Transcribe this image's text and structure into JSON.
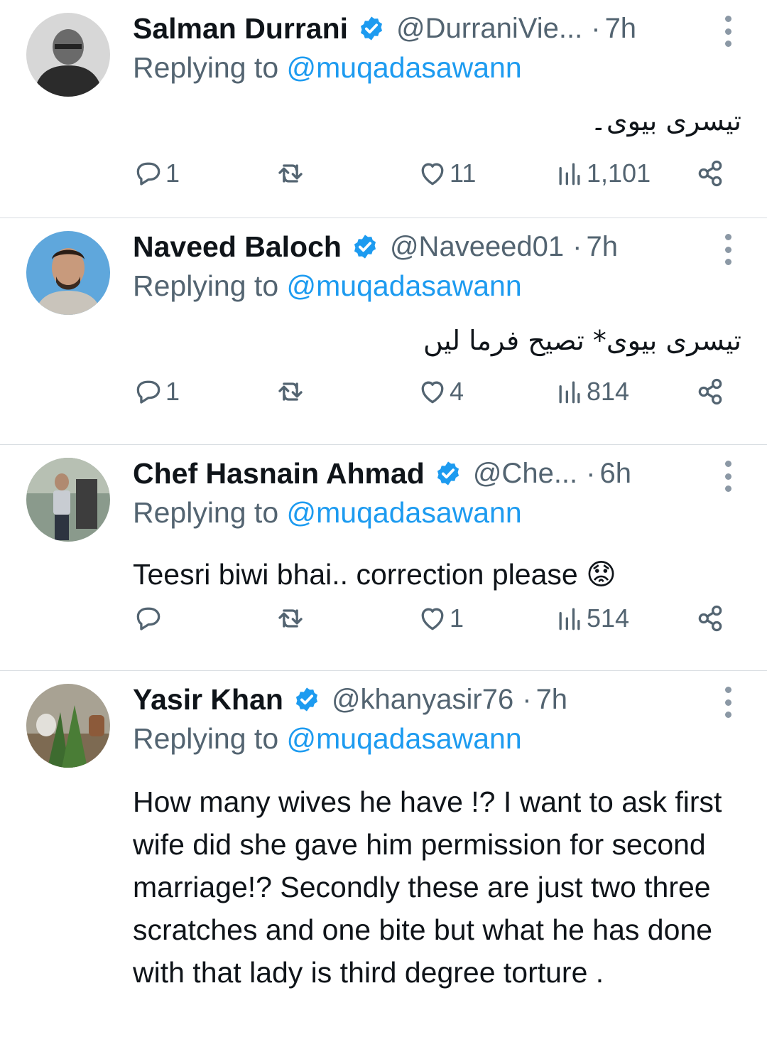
{
  "accent": "#1d9bf0",
  "tweets": [
    {
      "name": "Salman Durrani",
      "handle": "@DurraniVie...",
      "dot": "·",
      "time": "7h",
      "replying_label": "Replying to",
      "replying_to": "@muqadasawann",
      "text": "تیسری بیوی۔",
      "rtl": true,
      "replies": "1",
      "likes": "11",
      "views": "1,101"
    },
    {
      "name": "Naveed Baloch",
      "handle": "@Naveeed01",
      "dot": "·",
      "time": "7h",
      "replying_label": "Replying to",
      "replying_to": "@muqadasawann",
      "text": "تیسری بیوی* تصیح فرما لیں",
      "rtl": true,
      "replies": "1",
      "likes": "4",
      "views": "814"
    },
    {
      "name": "Chef Hasnain Ahmad",
      "handle": "@Che...",
      "dot": "·",
      "time": "6h",
      "replying_label": "Replying to",
      "replying_to": "@muqadasawann",
      "text": "Teesri biwi bhai.. correction please 😟",
      "rtl": false,
      "replies": "",
      "likes": "1",
      "views": "514"
    },
    {
      "name": "Yasir Khan",
      "handle": "@khanyasir76",
      "dot": "·",
      "time": "7h",
      "replying_label": "Replying to",
      "replying_to": "@muqadasawann",
      "text": "How many wives he have !? I want to ask first wife did she gave him permission for second marriage!? Secondly these are just two three scratches and one bite but what he has done with that lady is third degree torture .",
      "rtl": false
    }
  ],
  "icons": {
    "verified": "verified-badge-icon",
    "more": "more-vertical-icon",
    "reply": "reply-bubble-icon",
    "retweet": "retweet-icon",
    "like": "heart-icon",
    "views": "views-bar-chart-icon",
    "share": "share-icon"
  }
}
